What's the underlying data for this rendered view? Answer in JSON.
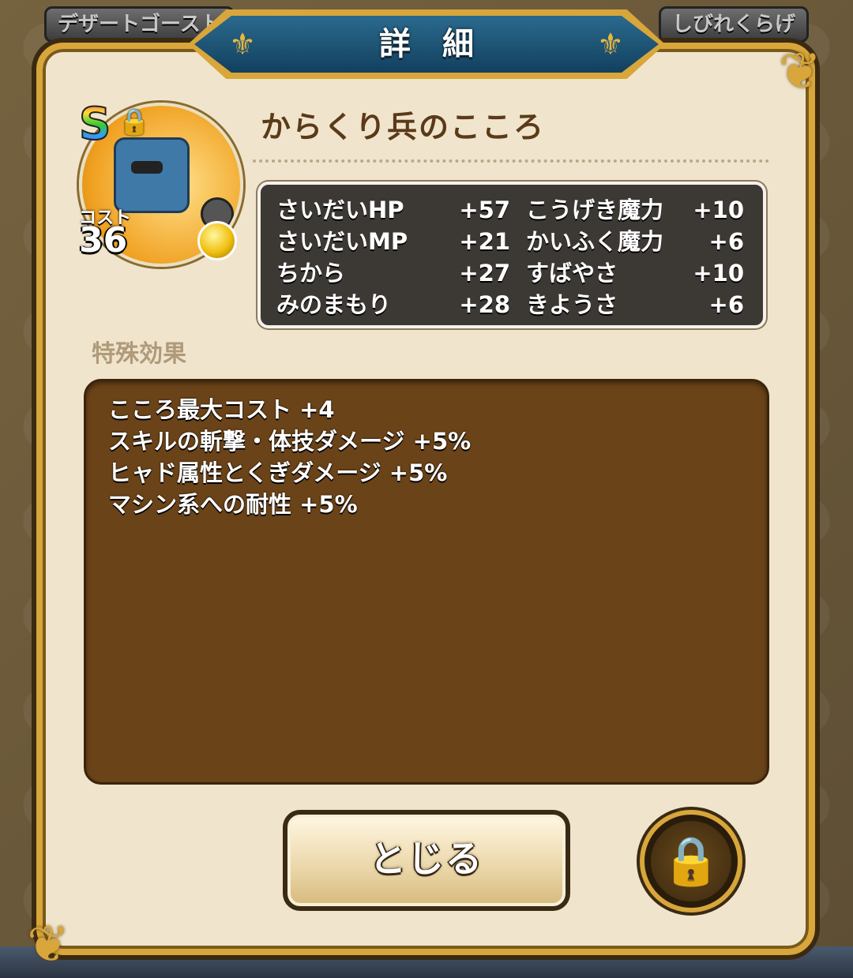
{
  "tabs": {
    "left": "デザートゴースト",
    "right": "しびれくらげ"
  },
  "dialog": {
    "title": "詳細",
    "item_name": "からくり兵のこころ",
    "rank": "S",
    "cost_label": "コスト",
    "cost_value": "36",
    "stats": [
      {
        "name": "さいだいHP",
        "value": "+57"
      },
      {
        "name": "さいだいMP",
        "value": "+21"
      },
      {
        "name": "ちから",
        "value": "+27"
      },
      {
        "name": "みのまもり",
        "value": "+28"
      },
      {
        "name": "こうげき魔力",
        "value": "+10"
      },
      {
        "name": "かいふく魔力",
        "value": "+6"
      },
      {
        "name": "すばやさ",
        "value": "+10"
      },
      {
        "name": "きようさ",
        "value": "+6"
      }
    ],
    "special_label": "特殊効果",
    "effects": [
      "こころ最大コスト +4",
      "スキルの斬撃・体技ダメージ +5%",
      "ヒャド属性とくぎダメージ +5%",
      "マシン系への耐性 +5%"
    ],
    "close_label": "とじる",
    "lock_icon": "padlock-icon"
  }
}
